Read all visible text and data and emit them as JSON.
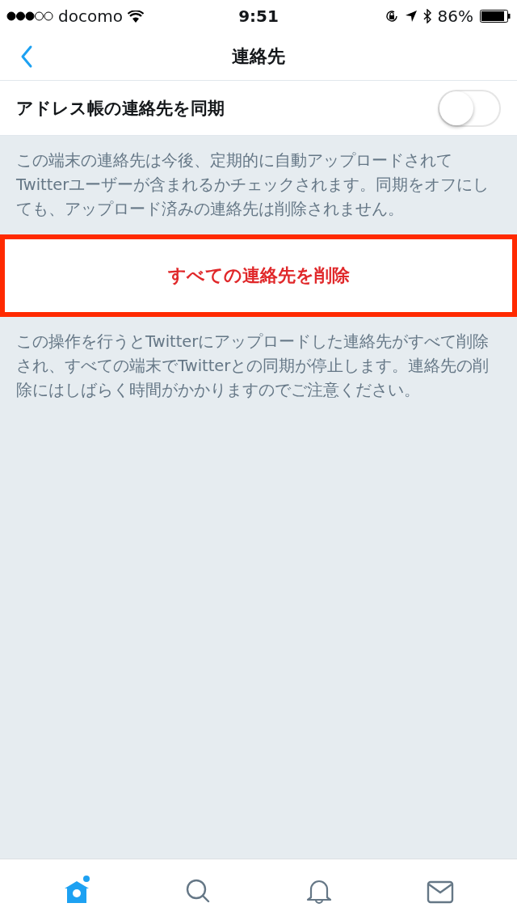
{
  "status_bar": {
    "carrier": "docomo",
    "time": "9:51",
    "battery": "86%"
  },
  "nav": {
    "title": "連絡先"
  },
  "sync": {
    "label": "アドレス帳の連絡先を同期",
    "on": false
  },
  "sync_note": "この端末の連絡先は今後、定期的に自動アップロードされてTwitterユーザーが含まれるかチェックされます。同期をオフにしても、アップロード済みの連絡先は削除されません。",
  "delete_button": {
    "label": "すべての連絡先を削除",
    "highlighted": true
  },
  "delete_note": "この操作を行うとTwitterにアップロードした連絡先がすべて削除され、すべての端末でTwitterとの同期が停止します。連絡先の削除にはしばらく時間がかかりますのでご注意ください。",
  "tabs": [
    {
      "kind": "home",
      "selected": true,
      "unread": true
    },
    {
      "kind": "search",
      "selected": false,
      "unread": false
    },
    {
      "kind": "notifications",
      "selected": false,
      "unread": false
    },
    {
      "kind": "messages",
      "selected": false,
      "unread": false
    }
  ]
}
